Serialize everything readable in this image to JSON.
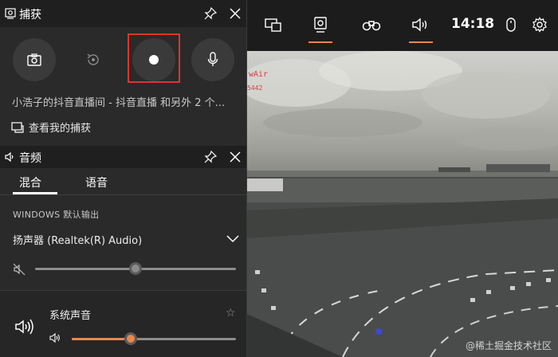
{
  "capture": {
    "title": "捕获",
    "status": "小浩子的抖音直播间 - 抖音直播 和另外 2 个...",
    "link_label": "查看我的捕获"
  },
  "audio": {
    "title": "音频",
    "tabs": [
      "混合",
      "语音"
    ],
    "active_tab": 0,
    "section_label": "WINDOWS 默认输出",
    "device": "扬声器 (Realtek(R) Audio)",
    "master_volume": 0.5,
    "system_sound": {
      "label": "系统声音",
      "volume": 0.36
    }
  },
  "topbar": {
    "time": "14:18"
  },
  "game": {
    "hud_line1": "wAir",
    "hud_line2": "5442"
  },
  "watermark": "@稀土掘金技术社区",
  "colors": {
    "accent": "#e9874f",
    "highlight": "#e0342c",
    "panel": "#2a2a2a"
  }
}
